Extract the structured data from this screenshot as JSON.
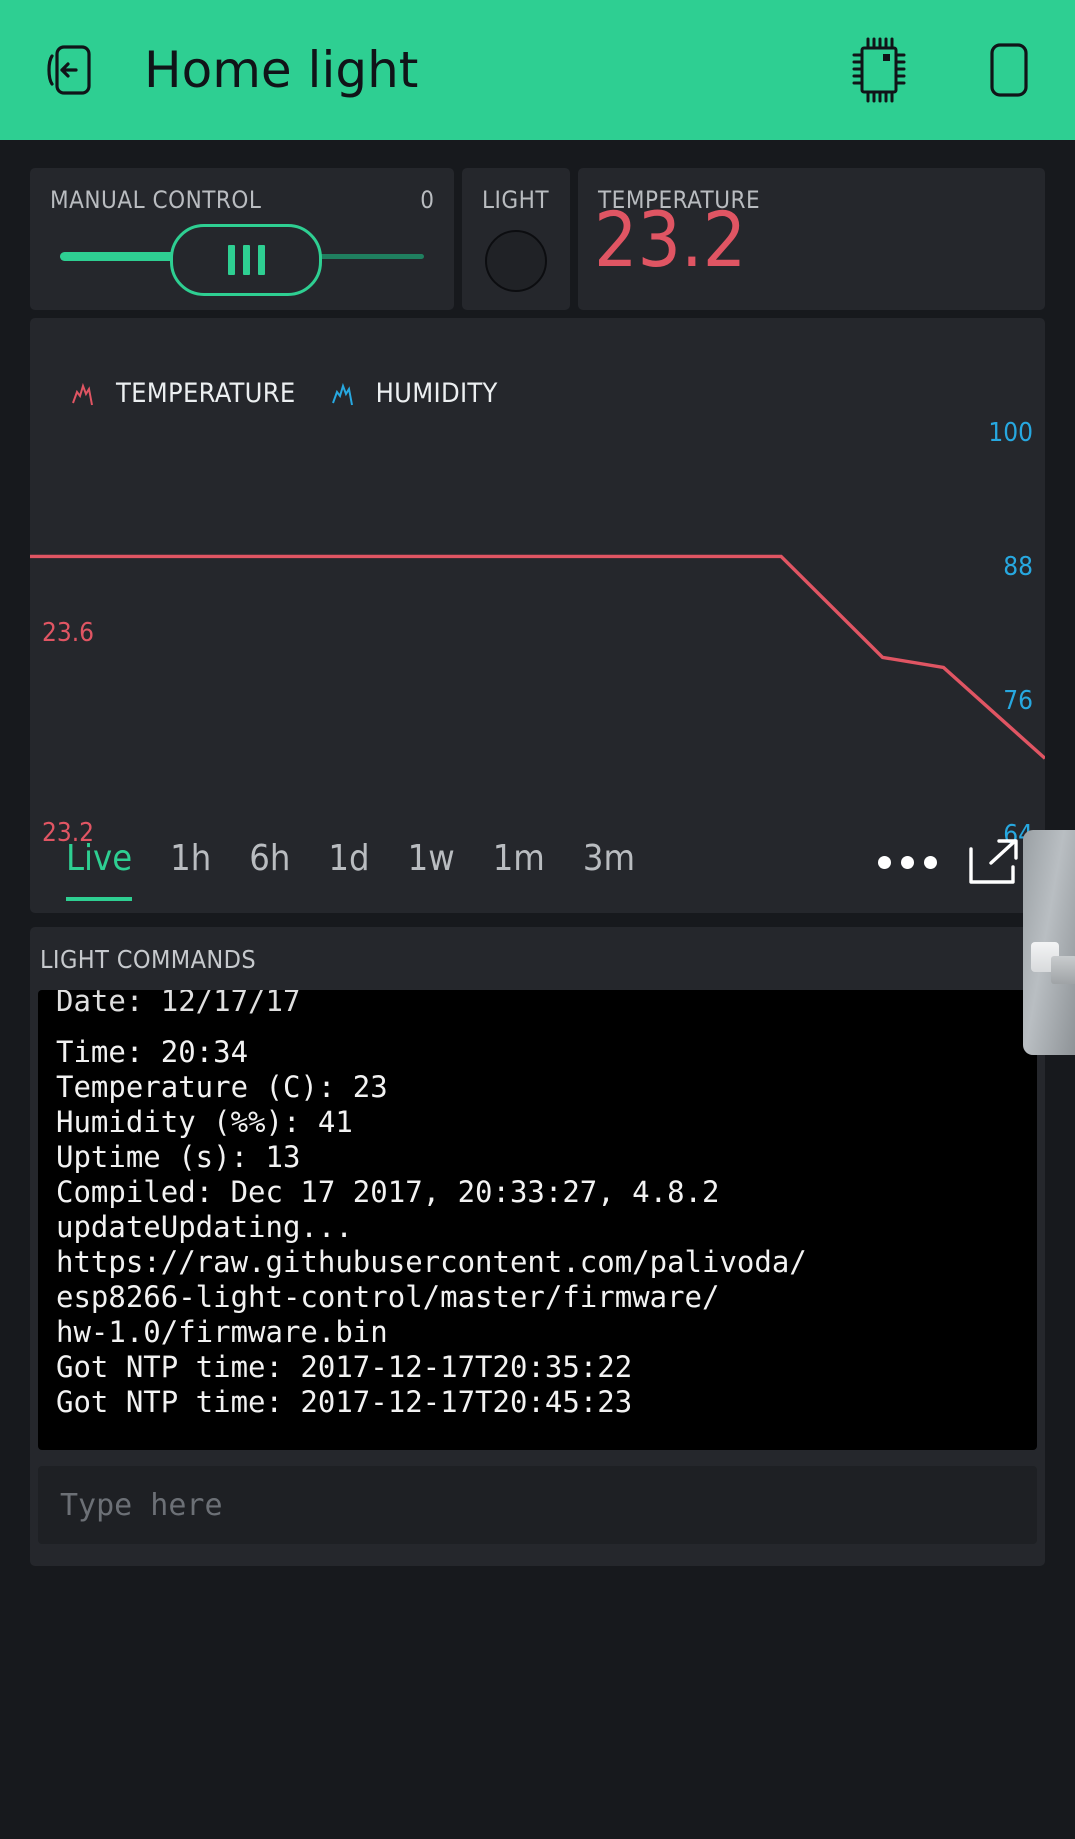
{
  "header": {
    "title": "Home light",
    "back_icon": "back-arrow-device-icon",
    "chip_icon": "microchip-icon",
    "device_icon": "phone-outline-icon",
    "bg_color": "#2ecf92"
  },
  "widgets": {
    "slider": {
      "label": "MANUAL CONTROL",
      "value": "0",
      "accent": "#2ecf92"
    },
    "light": {
      "label": "LIGHT",
      "state": "off"
    },
    "temperature": {
      "label": "TEMPERATURE",
      "value": "23.2",
      "color": "#e05563"
    }
  },
  "chart_data": {
    "type": "line",
    "title": "",
    "xlabel": "",
    "ylabel": "",
    "grid": false,
    "legend_position": "top-left",
    "legend": [
      {
        "name": "TEMPERATURE",
        "color": "#e05563",
        "icon": "sparkline-icon"
      },
      {
        "name": "HUMIDITY",
        "color": "#27a8e0",
        "icon": "sparkline-icon"
      }
    ],
    "left_axis": {
      "name": "TEMPERATURE",
      "color": "#e05563",
      "ticks": [
        "23.6",
        "23.2"
      ],
      "ylim": [
        23.2,
        23.6
      ]
    },
    "right_axis": {
      "name": "HUMIDITY",
      "color": "#27a8e0",
      "ticks": [
        "100",
        "88",
        "76",
        "64"
      ],
      "ylim": [
        64,
        100
      ]
    },
    "series": [
      {
        "name": "TEMPERATURE",
        "color": "#e05563",
        "axis": "left",
        "x": [
          0,
          0.74,
          0.84,
          0.9,
          1.0
        ],
        "values": [
          23.52,
          23.52,
          23.32,
          23.3,
          23.12
        ]
      },
      {
        "name": "HUMIDITY",
        "color": "#27a8e0",
        "axis": "right",
        "x": [],
        "values": []
      }
    ]
  },
  "chart": {
    "tabs": [
      {
        "label": "Live",
        "active": true
      },
      {
        "label": "1h",
        "active": false
      },
      {
        "label": "6h",
        "active": false
      },
      {
        "label": "1d",
        "active": false
      },
      {
        "label": "1w",
        "active": false
      },
      {
        "label": "1m",
        "active": false
      },
      {
        "label": "3m",
        "active": false
      }
    ],
    "more_icon": "ellipsis-icon",
    "expand_icon": "expand-external-icon"
  },
  "terminal": {
    "title": "LIGHT COMMANDS",
    "lines": [
      "Date: 12/17/17",
      "Time: 20:34",
      "Temperature (C): 23",
      "Humidity (%%): 41",
      "Uptime (s): 13",
      "Compiled: Dec 17 2017, 20:33:27, 4.8.2",
      "updateUpdating...",
      "https://raw.githubusercontent.com/palivoda/",
      "esp8266-light-control/master/firmware/",
      "hw-1.0/firmware.bin",
      "Got NTP time: 2017-12-17T20:35:22",
      "Got NTP time: 2017-12-17T20:45:23"
    ],
    "input_placeholder": "Type here"
  },
  "scrollbar": {
    "name": "right-edge-scroll-overlay"
  }
}
